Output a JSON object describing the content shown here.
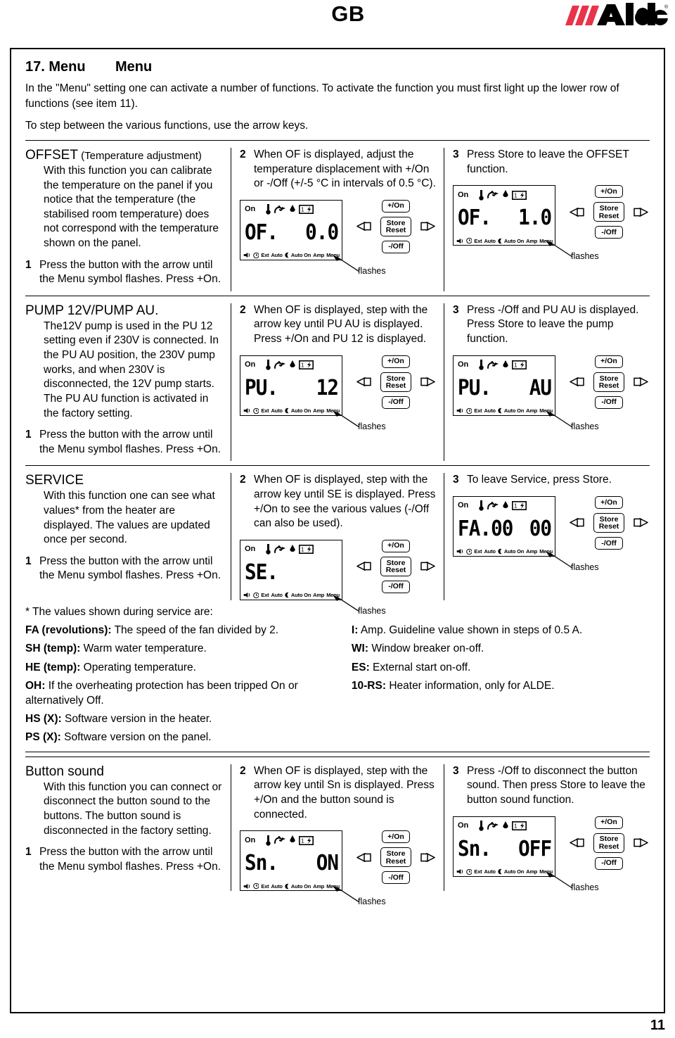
{
  "header": {
    "language_code": "GB",
    "logo_text": "Alde",
    "logo_registered": "®",
    "logo_red": "#e8334a"
  },
  "intro": {
    "number_title": "17. Menu",
    "title_sv": "Menu",
    "paragraph1": "In the \"Menu\" setting one can activate a number of functions. To activate the function you must first light up the lower row of functions (see item 11).",
    "paragraph2": "To step between the various functions, use the arrow keys."
  },
  "lcd_common": {
    "on_label": "On",
    "bottom_labels": [
      "Ext",
      "Auto",
      "Auto On",
      "Amp",
      "Menu"
    ],
    "icons_top": [
      "thermometer-icon",
      "fan-icon",
      "flame-icon",
      "battery-icon"
    ],
    "icons_bottom": [
      "speaker-icon",
      "clock-icon",
      "moon-icon"
    ],
    "flashes_label": "flashes"
  },
  "keypad": {
    "plus_on": "+/On",
    "minus_off": "-/Off",
    "store": "Store",
    "reset": "Reset",
    "left_icon": "arrow-left-icon",
    "right_icon": "arrow-right-icon"
  },
  "sections": [
    {
      "id": "offset",
      "title_main": "OFFSET",
      "title_sub": " (Temperature adjustment)",
      "description": "With this function you can calibrate the temperature on the panel if you notice that the temperature (the stabilised room temperature) does not correspond with the temperature shown on the panel.",
      "step1_num": "1",
      "step1_text": "Press the button with the arrow until the Menu symbol flashes. Press +On.",
      "step2_num": "2",
      "step2_text": "When OF is displayed, adjust the temperature displacement with +/On or -/Off (+/-5 °C in intervals of 0.5 °C).",
      "step3_num": "3",
      "step3_text": "Press Store to leave the OFFSET function.",
      "lcd2_left": "OF.",
      "lcd2_right": "0.0",
      "lcd3_left": "OF.",
      "lcd3_right": "1.0"
    },
    {
      "id": "pump",
      "title_main": "PUMP 12V/PUMP AU.",
      "title_sub": "",
      "description": "The12V pump is used in the PU 12 setting even if 230V is connected. In the PU AU position, the 230V pump works, and when 230V is disconnected, the 12V pump starts. The PU AU function is activated in the factory setting.",
      "step1_num": "1",
      "step1_text": "Press the button with the arrow until the Menu symbol flashes. Press +On.",
      "step2_num": "2",
      "step2_text": "When OF is displayed, step with the arrow key until PU AU is displayed. Press +/On and PU 12 is displayed.",
      "step3_num": "3",
      "step3_text": "Press -/Off and PU AU is displayed. Press Store to leave the pump function.",
      "lcd2_left": "PU.",
      "lcd2_right": "12",
      "lcd3_left": "PU.",
      "lcd3_right": "AU"
    },
    {
      "id": "service",
      "title_main": "SERVICE",
      "title_sub": "",
      "description": "With this function one can see what values* from the heater are displayed. The values are updated once per second.",
      "step1_num": "1",
      "step1_text": "Press the button with the arrow until the Menu symbol flashes. Press +On.",
      "step2_num": "2",
      "step2_text": "When OF is displayed, step with the arrow key until SE is displayed. Press +/On to see the various values (-/Off can also be used).",
      "step3_num": "3",
      "step3_text": "To leave Service, press Store.",
      "lcd2_left": "SE.",
      "lcd2_right": "",
      "lcd3_left": "FA.00",
      "lcd3_right": "00"
    },
    {
      "id": "button-sound",
      "title_main": "Button sound",
      "title_sub": "",
      "description": "With this function you can connect or disconnect the button sound to the buttons. The button sound is disconnected in the factory setting.",
      "step1_num": "1",
      "step1_text": "Press the button with the arrow until the Menu symbol flashes. Press +On.",
      "step2_num": "2",
      "step2_text": "When OF is displayed, step with the arrow key until Sn is displayed. Press +/On and the button sound is connected.",
      "step3_num": "3",
      "step3_text": "Press -/Off to disconnect the button sound. Then press Store to leave the button sound function.",
      "lcd2_left": "Sn.",
      "lcd2_right": "ON",
      "lcd3_left": "Sn.",
      "lcd3_right": "OFF"
    }
  ],
  "values_note": {
    "heading": "* The values shown during service are:",
    "left": [
      {
        "code": "FA (revolutions):",
        "text": " The speed of the fan divided by 2."
      },
      {
        "code": "SH (temp):",
        "text": " Warm water temperature."
      },
      {
        "code": "HE (temp):",
        "text": " Operating temperature."
      },
      {
        "code": "OH:",
        "text": " If the overheating protection has been tripped On or alternatively Off."
      },
      {
        "code": "HS (X):",
        "text": " Software version in the heater."
      },
      {
        "code": "PS (X):",
        "text": " Software version on the panel."
      }
    ],
    "right": [
      {
        "code": "I:",
        "text": " Amp. Guideline value shown in steps of 0.5 A."
      },
      {
        "code": "WI:",
        "text": " Window breaker on-off."
      },
      {
        "code": "ES:",
        "text": " External start on-off."
      },
      {
        "code": "10-RS:",
        "text": " Heater information, only for ALDE."
      }
    ]
  },
  "page_number": "11"
}
